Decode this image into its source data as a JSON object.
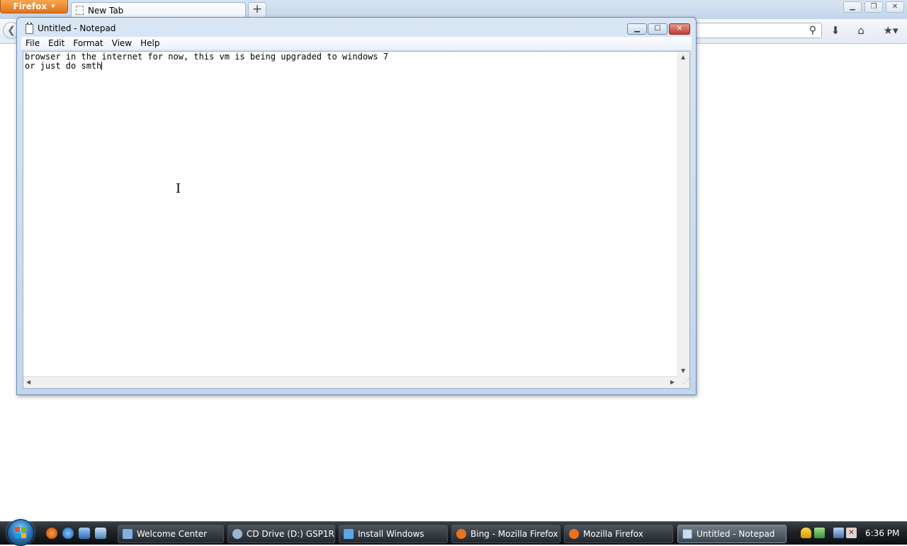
{
  "firefox": {
    "menu_button_label": "Firefox",
    "tab_title": "New Tab",
    "new_tab_symbol": "+",
    "back_symbol": "❮",
    "search_icon": "magnifier-icon",
    "toolbar_icons": [
      "download-icon",
      "home-icon",
      "bookmarks-icon"
    ]
  },
  "notepad": {
    "window_title": "Untitled - Notepad",
    "menu": [
      "File",
      "Edit",
      "Format",
      "View",
      "Help"
    ],
    "text_lines": [
      "browser in the internet for now, this vm is being upgraded to windows 7",
      "or just do smth"
    ]
  },
  "taskbar": {
    "buttons": [
      {
        "label": "Welcome Center",
        "icon_color": "#7fb0e0"
      },
      {
        "label": "CD Drive (D:) GSP1R...",
        "icon_color": "#9ab7d1"
      },
      {
        "label": "Install Windows",
        "icon_color": "#5aa7e6"
      },
      {
        "label": "Bing - Mozilla Firefox",
        "icon_color": "#e8731c"
      },
      {
        "label": "Mozilla Firefox",
        "icon_color": "#e8731c"
      },
      {
        "label": "Untitled - Notepad",
        "icon_color": "#c7dff5",
        "active": true
      }
    ],
    "clock": "6:36 PM"
  },
  "colors": {
    "firefox_orange": "#e0731c",
    "close_red": "#c53f2b",
    "taskbar_dark": "#1e2226"
  }
}
